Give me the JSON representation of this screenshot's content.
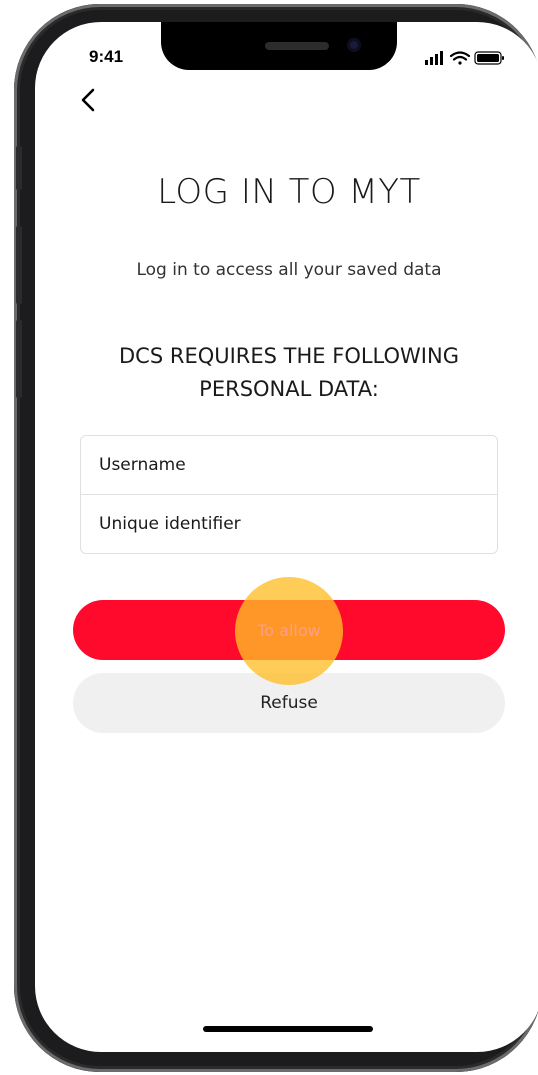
{
  "status_bar": {
    "time": "9:41",
    "icons": [
      "signal-icon",
      "wifi-icon",
      "battery-icon"
    ]
  },
  "nav": {
    "back_icon": "chevron-left-icon"
  },
  "login": {
    "title": "LOG IN TO MYT",
    "subtitle": "Log in to access all your saved data",
    "permissions_heading": "DCS REQUIRES THE FOLLOWING PERSONAL DATA:",
    "fields": [
      "Username",
      "Unique identifier"
    ]
  },
  "actions": {
    "allow_label": "To allow",
    "refuse_label": "Refuse"
  },
  "colors": {
    "allow_button": "#ff0a2c",
    "refuse_button": "#eff0ef",
    "tap_indicator": "#ffbe28"
  }
}
